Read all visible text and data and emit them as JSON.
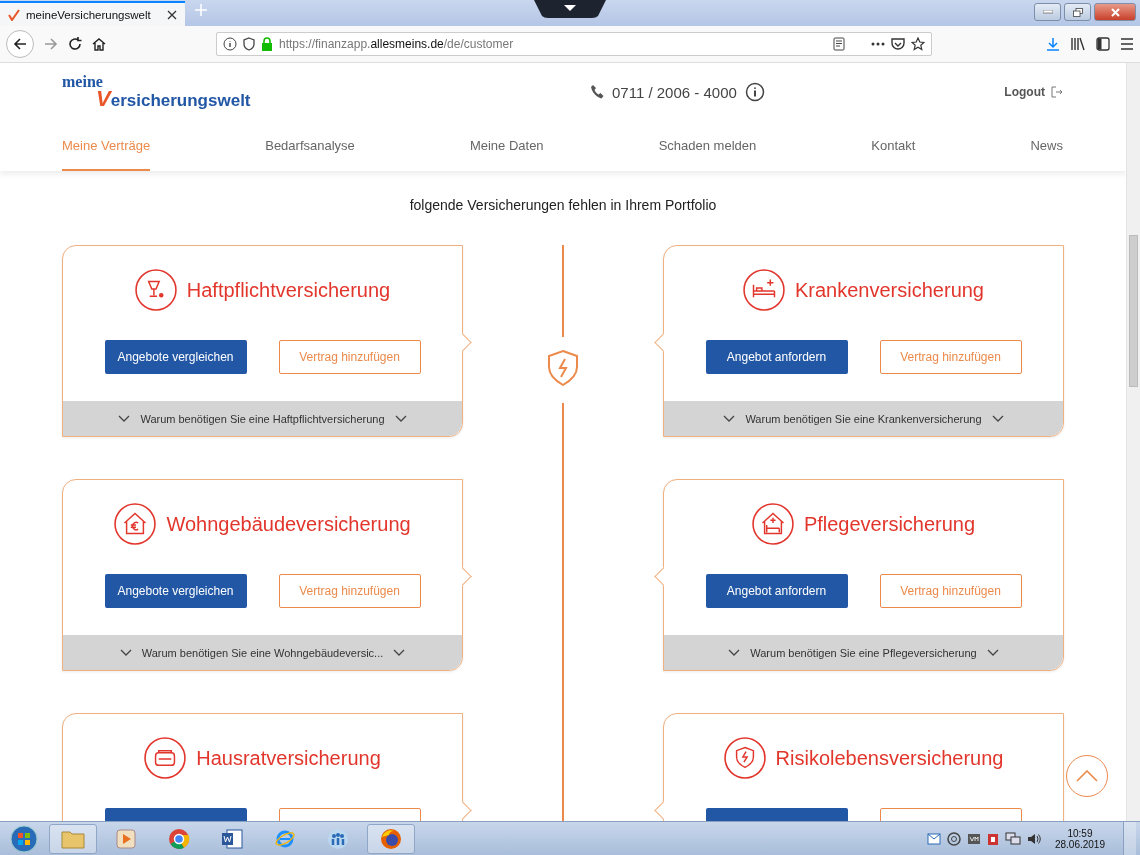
{
  "browser": {
    "tab_title": "meineVersicherungswelt",
    "url": "https://finanzapp.**allesmeins.de**/de/customer"
  },
  "header": {
    "logo_top": "meine",
    "logo_bottom": "Versicherungswelt",
    "phone": "0711 / 2006 - 4000",
    "logout": "Logout"
  },
  "nav": [
    {
      "label": "Meine Verträge",
      "selected": true
    },
    {
      "label": "Bedarfsanalyse",
      "selected": false
    },
    {
      "label": "Meine Daten",
      "selected": false
    },
    {
      "label": "Schaden melden",
      "selected": false
    },
    {
      "label": "Kontakt",
      "selected": false
    },
    {
      "label": "News",
      "selected": false
    }
  ],
  "heading": "folgende Versicherungen fehlen in Ihrem Portfolio",
  "cards": [
    {
      "title": "Haftpflichtversicherung",
      "kind": "glass",
      "primary": "Angebote vergleichen",
      "secondary": "Vertrag hinzufügen",
      "footer": "Warum benötigen Sie eine Haftpflichtversicherung"
    },
    {
      "title": "Krankenversicherung",
      "kind": "bed",
      "primary": "Angebot anfordern",
      "secondary": "Vertrag hinzufügen",
      "footer": "Warum benötigen Sie eine Krankenversicherung"
    },
    {
      "title": "Wohngebäudeversicherung",
      "kind": "house",
      "primary": "Angebote vergleichen",
      "secondary": "Vertrag hinzufügen",
      "footer": "Warum benötigen Sie eine Wohngebäudeversic..."
    },
    {
      "title": "Pflegeversicherung",
      "kind": "care",
      "primary": "Angebot anfordern",
      "secondary": "Vertrag hinzufügen",
      "footer": "Warum benötigen Sie eine Pflegeversicherung"
    },
    {
      "title": "Hausratversicherung",
      "kind": "sofa"
    },
    {
      "title": "Risikolebensversicherung",
      "kind": "shield"
    }
  ],
  "taskbar": {
    "time": "10:59",
    "date": "28.06.2019"
  }
}
